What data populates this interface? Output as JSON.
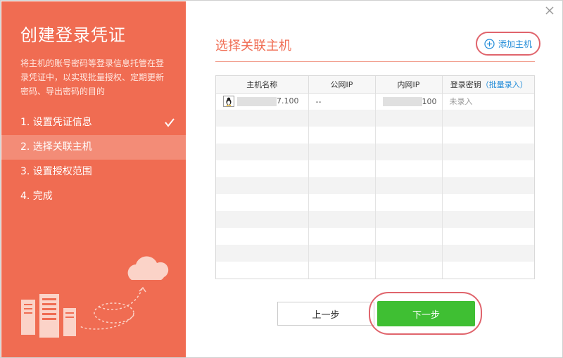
{
  "sidebar": {
    "title": "创建登录凭证",
    "description": "将主机的账号密码等登录信息托管在登录凭证中，以实现批量授权、定期更新密码、导出密码的目的",
    "steps": [
      {
        "label": "1. 设置凭证信息",
        "done": true
      },
      {
        "label": "2. 选择关联主机",
        "active": true
      },
      {
        "label": "3. 设置授权范围"
      },
      {
        "label": "4. 完成"
      }
    ]
  },
  "main": {
    "title": "选择关联主机",
    "add_host_label": "添加主机"
  },
  "table": {
    "headers": [
      "主机名称",
      "公网IP",
      "内网IP",
      "登录密钥"
    ],
    "bulk_entry_label": "（批量录入）",
    "rows": [
      {
        "host_name_suffix": "7.100",
        "public_ip": "--",
        "private_ip_suffix": "100",
        "login_key": "未录入"
      }
    ]
  },
  "footer": {
    "prev_label": "上一步",
    "next_label": "下一步"
  },
  "colors": {
    "accent": "#f06c52",
    "active_step": "#f38c77",
    "next_button": "#3fbf33",
    "link": "#1e8ad8",
    "highlight_ring": "#e0646c"
  },
  "icons": [
    "close-icon",
    "check-icon",
    "plus-circle-icon",
    "linux-icon",
    "cloud-icon",
    "server-icon"
  ]
}
